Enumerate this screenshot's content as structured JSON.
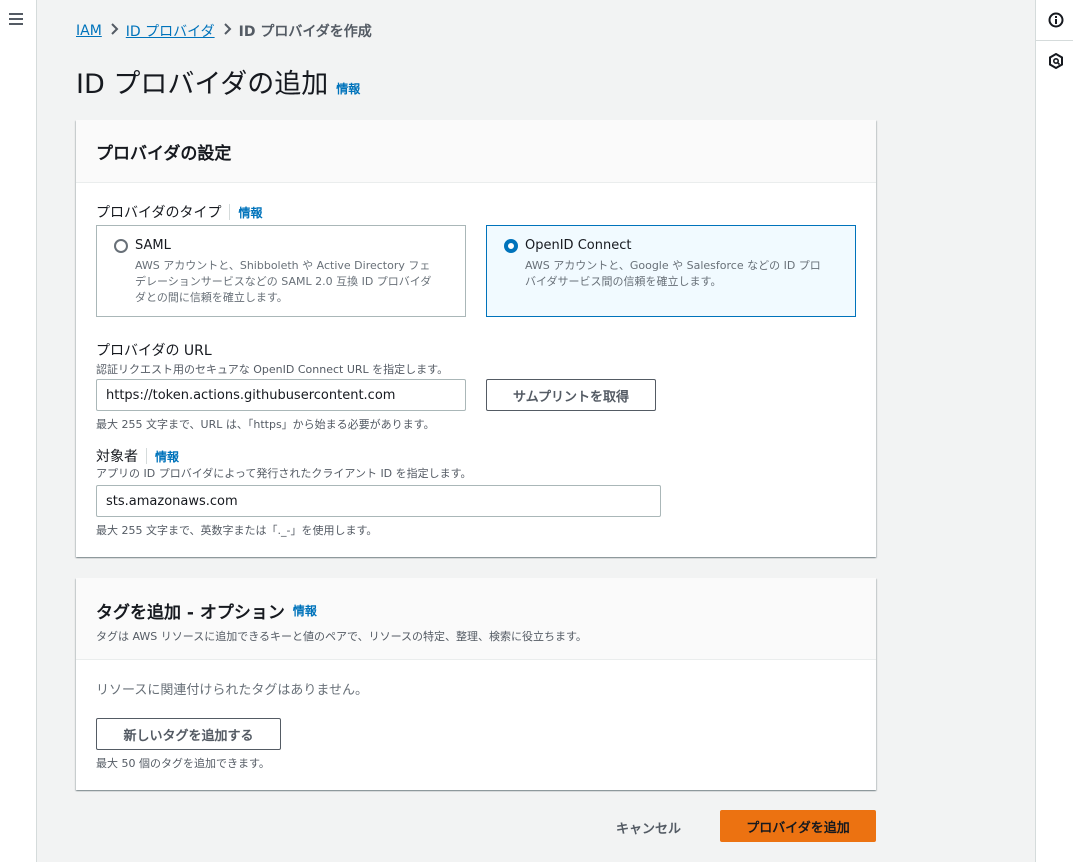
{
  "breadcrumb": {
    "items": [
      {
        "label": "IAM"
      },
      {
        "label": "ID プロバイダ"
      }
    ],
    "current": "ID プロバイダを作成"
  },
  "page": {
    "title": "ID プロバイダの追加",
    "info": "情報"
  },
  "settings": {
    "title": "プロバイダの設定",
    "provider_type_label": "プロバイダのタイプ",
    "provider_type_info": "情報",
    "options": [
      {
        "title": "SAML",
        "desc_lines": [
          "AWS アカウントと、Shibboleth や Active Directory フェ",
          "デレーションサービスなどの SAML 2.0 互換 ID プロバイダ",
          "ダとの間に信頼を確立します。"
        ],
        "selected": false
      },
      {
        "title": "OpenID Connect",
        "desc_lines": [
          "AWS アカウントと、Google や Salesforce などの ID プロ",
          "バイダサービス間の信頼を確立します。"
        ],
        "selected": true
      }
    ],
    "url_label": "プロバイダの URL",
    "url_desc": "認証リクエスト用のセキュアな OpenID Connect URL を指定します。",
    "url_value": "https://token.actions.githubusercontent.com",
    "thumbprint_button": "サムプリントを取得",
    "url_hint": "最大 255 文字まで、URL は、「https」から始まる必要があります。",
    "audience_label": "対象者",
    "audience_info": "情報",
    "audience_desc": "アプリの ID プロバイダによって発行されたクライアント ID を指定します。",
    "audience_value": "sts.amazonaws.com",
    "audience_hint": "最大 255 文字まで、英数字または「._-」を使用します。"
  },
  "tags": {
    "title": "タグを追加 - オプション",
    "info": "情報",
    "desc": "タグは AWS リソースに追加できるキーと値のペアで、リソースの特定、整理、検索に役立ちます。",
    "empty_text": "リソースに関連付けられたタグはありません。",
    "add_button": "新しいタグを追加する",
    "limit_hint": "最大 50 個のタグを追加できます。"
  },
  "footer": {
    "cancel": "キャンセル",
    "submit": "プロバイダを追加"
  },
  "colors": {
    "link": "#0073bb",
    "primary": "#ec7211",
    "selected_bg": "#f1faff"
  },
  "icons": {
    "menu": "hamburger-menu-icon",
    "info": "info-circle-icon",
    "settings": "hexagon-gear-icon",
    "chevron": "chevron-right-icon"
  }
}
